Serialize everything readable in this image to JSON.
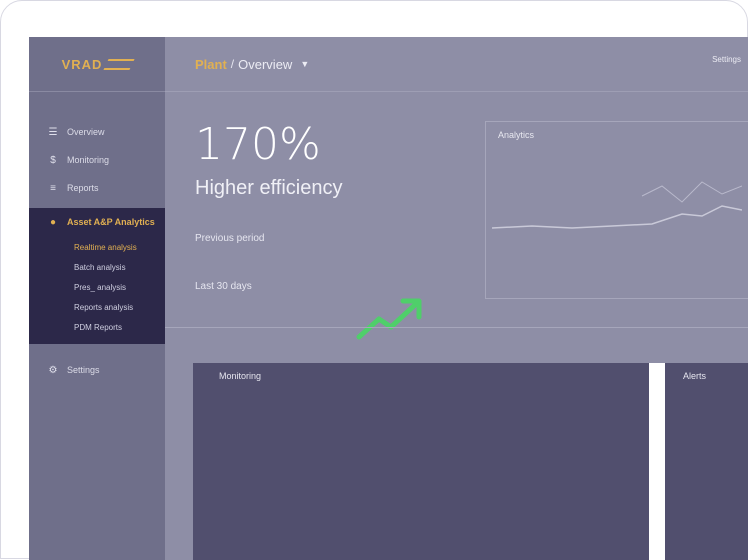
{
  "sidebar": {
    "logo_text": "VRAD",
    "items": [
      {
        "label": "Overview",
        "icon": "menu-icon"
      },
      {
        "label": "Monitoring",
        "icon": "dollar-icon"
      },
      {
        "label": "Reports",
        "icon": "list-icon"
      }
    ],
    "active_section": {
      "label": "Asset A&P Analytics",
      "icon": "user-icon"
    },
    "submenu": [
      {
        "label": "Realtime analysis"
      },
      {
        "label": "Batch analysis"
      },
      {
        "label": "Pres_ analysis"
      },
      {
        "label": "Reports analysis"
      },
      {
        "label": "PDM Reports"
      }
    ],
    "bottom_item": {
      "label": "Settings",
      "icon": "gear-icon"
    }
  },
  "header": {
    "crumb_primary": "Plant",
    "crumb_sep": "/",
    "crumb_secondary": "Overview",
    "account": "Settings"
  },
  "kpi": {
    "value": "170%",
    "subtitle": "Higher efficiency",
    "detail": "Previous period",
    "detail2": "Last 30 days"
  },
  "card": {
    "title": "Analytics"
  },
  "panels": {
    "left_label": "Monitoring",
    "right_label": "Alerts"
  },
  "colors": {
    "accent": "#e1b052",
    "sidebar_active": "#2c2849",
    "trend": "#4fcf6a"
  }
}
